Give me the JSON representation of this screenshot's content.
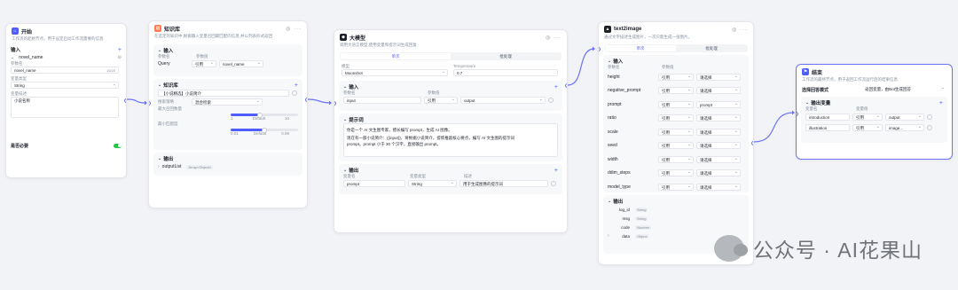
{
  "start_node": {
    "title": "开始",
    "desc": "工作流的起始节点，用于设定启动工作流需要的信息",
    "input_label": "输入",
    "var_name": "novel_name",
    "param_label": "参数名",
    "param_value": "novel_name",
    "param_counter": "10/20",
    "type_label": "变量类型",
    "type_value": "String",
    "desc_label": "变量描述",
    "desc_value": "小说名称",
    "required_label": "是否必要"
  },
  "kb_node": {
    "title": "知识库",
    "desc": "在选定的知识中,根据输入变量召回最匹配的信息,并以列表形式返回",
    "input_label": "输入",
    "col_name": "参数名",
    "col_value": "参数值",
    "query_name": "Query",
    "query_ref": "引用",
    "query_value": "novel_name",
    "kb_label": "知识库",
    "kb_item": "【小说精选】小说简介",
    "strategy_label": "搜索策略",
    "strategy_value": "混合检索",
    "max_recall_label": "最大召回数量",
    "max_recall_min": "1",
    "max_recall_default": "Default",
    "max_recall_max": "10",
    "max_recall_level": 0.44,
    "min_match_label": "最小匹配度",
    "min_match_min": "0.01",
    "min_match_default": "Default",
    "min_match_max": "0.99",
    "min_match_level": 0.5,
    "output_label": "输出",
    "output_var": "outputList",
    "output_type": "Array<Object>"
  },
  "llm_node": {
    "title": "大模型",
    "desc": "调用大语言模型,使用变量和提示词生成回复",
    "tab_single": "单次",
    "tab_batch": "批处理",
    "model_label": "模型",
    "model_value": "Moonshot",
    "temp_label": "Temperature",
    "temp_value": "0.7",
    "input_label": "输入",
    "col_name": "参数名",
    "col_value": "参数值",
    "input_name": "input",
    "input_ref": "引用",
    "input_value": "output",
    "prompt_label": "提示词",
    "prompt_line1": "你是一个 AI 文生图专家，擅长编写 prompt，生成 AI 图像。",
    "prompt_line2": "现在有一部小说简介：{{input}}，将根据小说简介，提炼推敲核心要点，编写 AI 文生图的提示词",
    "prompt_line3": "prompt。prompt 小于 30 个汉字，直接输出 prompt。",
    "output_label": "输出",
    "out_col_name": "变量名",
    "out_col_type": "变量类型",
    "out_col_desc": "描述",
    "out_name": "prompt",
    "out_type": "String",
    "out_desc": "用于生成图像的提示词"
  },
  "t2i_node": {
    "title": "text2image",
    "desc": "通过文字描述生成图片，一次只能生成一张图片。",
    "tab_single": "单次",
    "tab_batch": "批处理",
    "input_label": "输入",
    "col_name": "参数名",
    "col_value": "参数值",
    "params": [
      {
        "name": "height",
        "ref": "引用",
        "value": "请选择"
      },
      {
        "name": "negative_prompt",
        "ref": "引用",
        "value": "请选择"
      },
      {
        "name": "prompt",
        "ref": "引用",
        "value": "prompt"
      },
      {
        "name": "ratio",
        "ref": "引用",
        "value": "请选择"
      },
      {
        "name": "scale",
        "ref": "引用",
        "value": "请选择"
      },
      {
        "name": "seed",
        "ref": "引用",
        "value": "请选择"
      },
      {
        "name": "width",
        "ref": "引用",
        "value": "请选择"
      },
      {
        "name": "ddim_steps",
        "ref": "引用",
        "value": "请选择"
      },
      {
        "name": "model_type",
        "ref": "引用",
        "value": "请选择"
      }
    ],
    "output_label": "输出",
    "outputs": [
      {
        "name": "log_id",
        "type": "String"
      },
      {
        "name": "msg",
        "type": "String"
      },
      {
        "name": "code",
        "type": "Number"
      },
      {
        "name": "data",
        "type": "Object"
      }
    ]
  },
  "end_node": {
    "title": "结束",
    "desc": "工作流的最终节点，用于返回工作流运行后的结果信息",
    "mode_label": "选择回答模式",
    "mode_value": "返回变量，由Bot生成回答",
    "output_label": "输出变量",
    "col_name": "变量名",
    "col_value": "变量值",
    "vars": [
      {
        "name": "introduction",
        "ref": "引用",
        "value": "output"
      },
      {
        "name": "illustration",
        "ref": "引用",
        "value": "image..."
      }
    ]
  },
  "watermark": "公众号 · AI花果山",
  "colors": {
    "accent": "#4e5eff",
    "selected_border": "#6b74f7",
    "start_icon": "#4e5eff",
    "kb_icon": "#ff7d4d",
    "llm_icon": "#1d2129",
    "t2i_icon": "#1d2129",
    "end_icon": "#4e5eff"
  }
}
